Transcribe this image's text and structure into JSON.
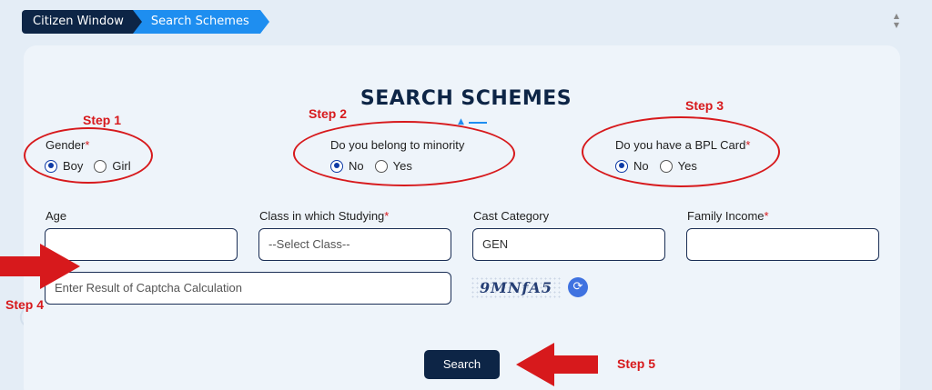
{
  "breadcrumb": {
    "items": [
      "Citizen Window",
      "Search Schemes"
    ]
  },
  "page": {
    "title": "SEARCH SCHEMES"
  },
  "steps": {
    "step1": "Step 1",
    "step2": "Step 2",
    "step3": "Step 3",
    "step4": "Step 4",
    "step5": "Step 5"
  },
  "gender": {
    "label": "Gender",
    "required": "*",
    "options": [
      "Boy",
      "Girl"
    ],
    "selected": "Boy"
  },
  "minority": {
    "label": "Do you belong to minority",
    "options": [
      "No",
      "Yes"
    ],
    "selected": "No"
  },
  "bpl": {
    "label": "Do you have a BPL Card",
    "required": "*",
    "options": [
      "No",
      "Yes"
    ],
    "selected": "No"
  },
  "fields": {
    "age_label": "Age",
    "age_value": "",
    "class_label": "Class in which Studying",
    "class_required": "*",
    "class_value": "--Select Class--",
    "cast_label": "Cast Category",
    "cast_value": "GEN",
    "income_label": "Family Income",
    "income_required": "*",
    "income_value": "",
    "captcha_placeholder": "Enter Result of Captcha Calculation",
    "captcha_image_text": "9MNfA5"
  },
  "actions": {
    "search_label": "Search"
  },
  "colors": {
    "navy": "#0d2546",
    "accent_blue": "#1e8ef0",
    "annotation_red": "#d7191c"
  }
}
